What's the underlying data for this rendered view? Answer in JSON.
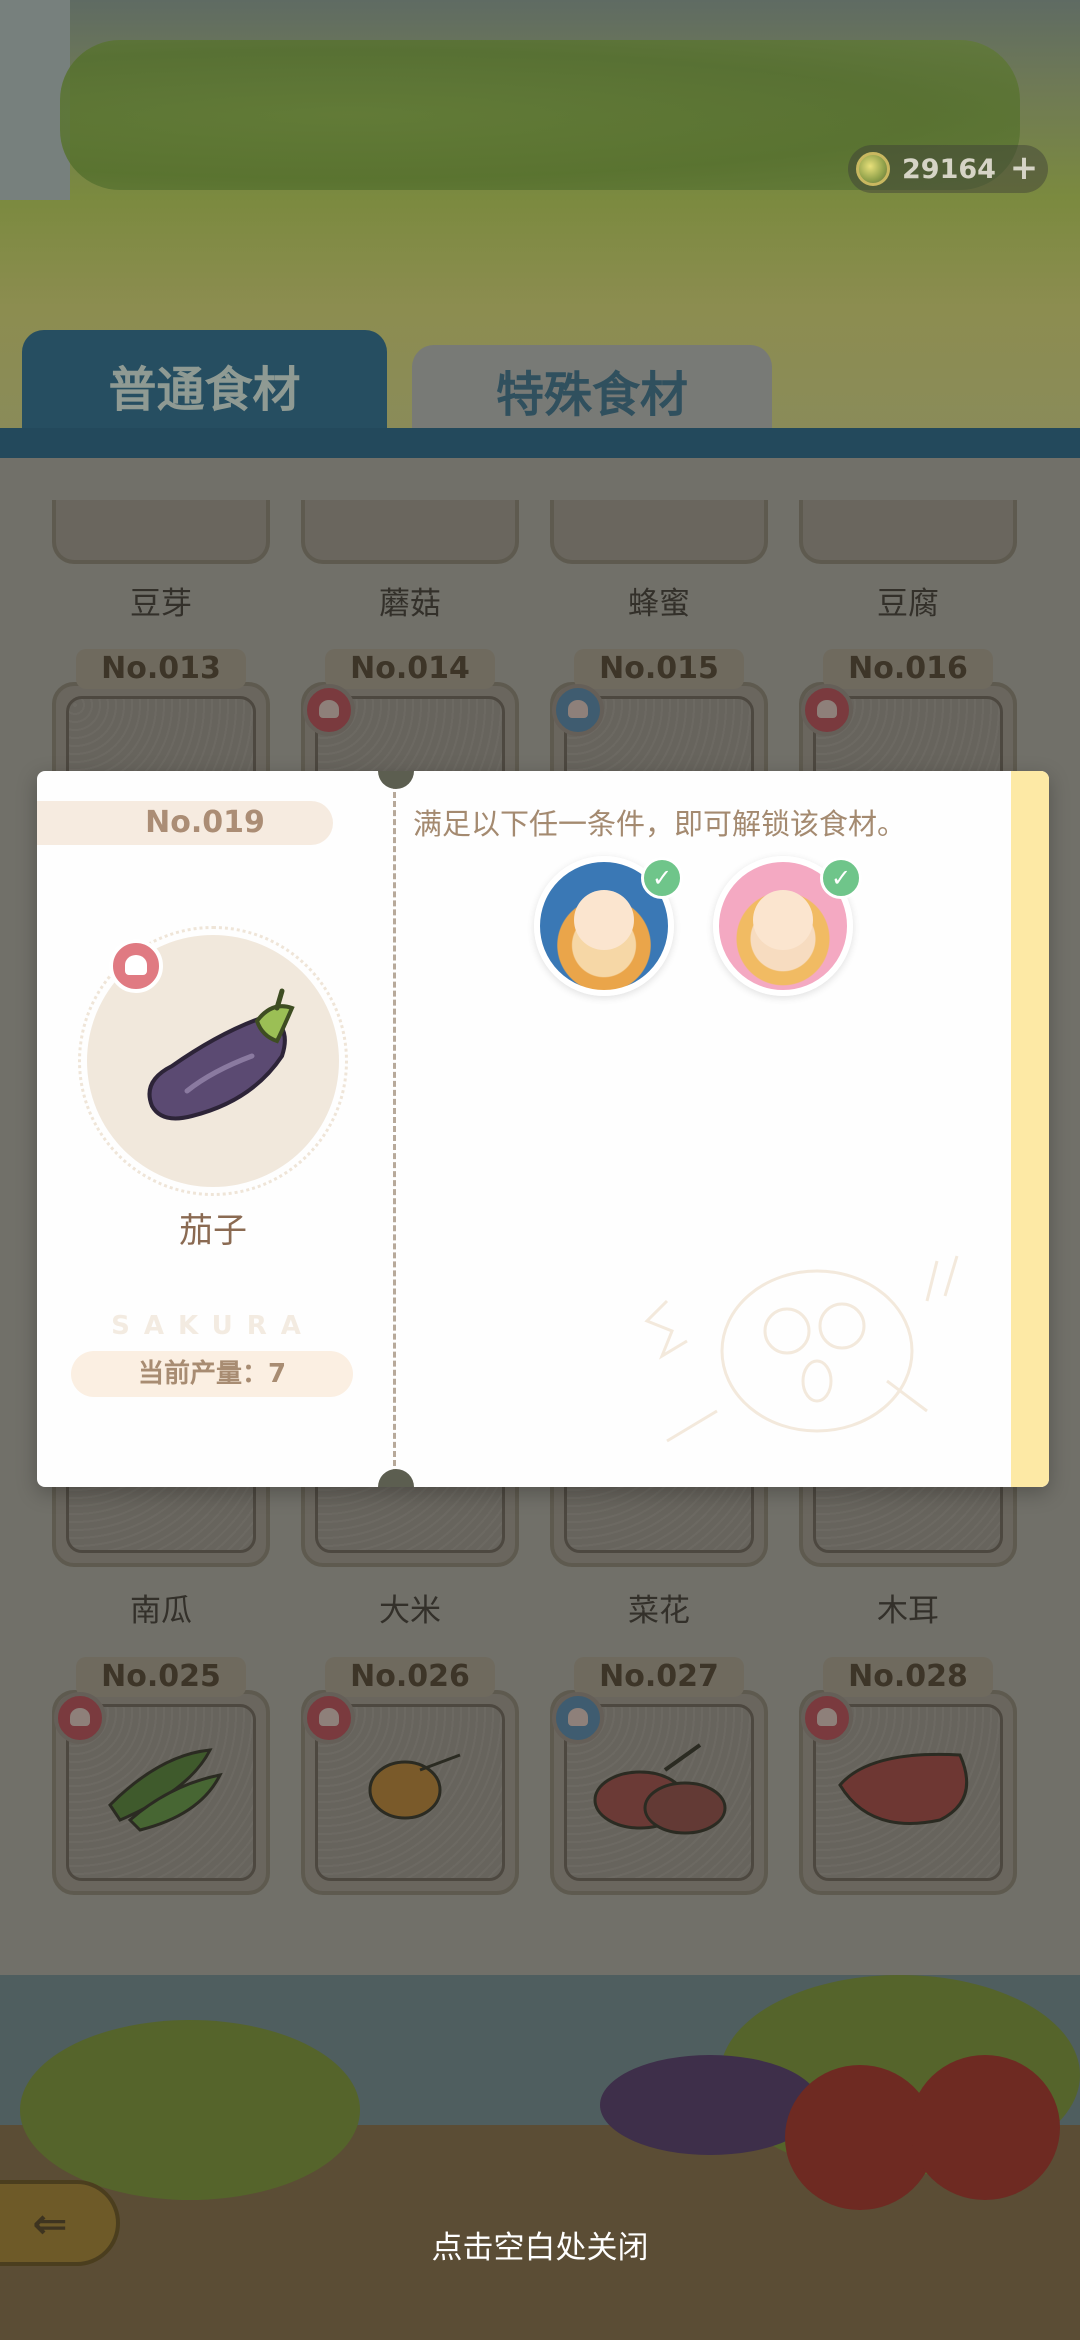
{
  "currency": {
    "coins": "29164",
    "plus": "+"
  },
  "tabs": {
    "normal": "普通食材",
    "special": "特殊食材"
  },
  "grid": {
    "row1_names": [
      "豆芽",
      "蘑菇",
      "蜂蜜",
      "豆腐"
    ],
    "row2_numbers": [
      "No.013",
      "No.014",
      "No.015",
      "No.016"
    ],
    "row4_names": [
      "南瓜",
      "大米",
      "菜花",
      "木耳"
    ],
    "row5_numbers": [
      "No.025",
      "No.026",
      "No.027",
      "No.028"
    ]
  },
  "modal": {
    "number": "No.019",
    "item_name": "茄子",
    "watermark": "SAKURA",
    "production": "当前产量：7",
    "condition": "满足以下任一条件，即可解锁该食材。",
    "check_mark": "✓"
  },
  "footer": {
    "close_hint": "点击空白处关闭",
    "back_icon": "⇐"
  },
  "colors": {
    "accent_tab": "#264e61",
    "modal_stripe": "#fde9a5",
    "check": "#6fc58a",
    "chef_badge": "#e07a82"
  }
}
